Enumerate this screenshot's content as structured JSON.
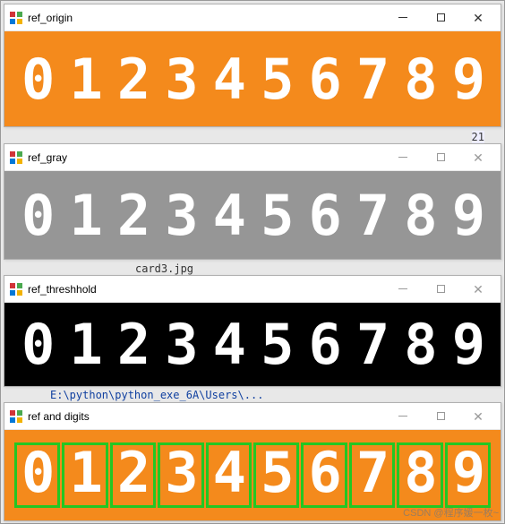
{
  "windows": [
    {
      "id": "w1",
      "title": "ref_origin",
      "active": true,
      "digits": [
        "0",
        "1",
        "2",
        "3",
        "4",
        "5",
        "6",
        "7",
        "8",
        "9"
      ],
      "style": "orange"
    },
    {
      "id": "w2",
      "title": "ref_gray",
      "active": false,
      "digits": [
        "0",
        "1",
        "2",
        "3",
        "4",
        "5",
        "6",
        "7",
        "8",
        "9"
      ],
      "style": "gray"
    },
    {
      "id": "w3",
      "title": "ref_threshhold",
      "active": false,
      "digits": [
        "0",
        "1",
        "2",
        "3",
        "4",
        "5",
        "6",
        "7",
        "8",
        "9"
      ],
      "style": "black"
    },
    {
      "id": "w4",
      "title": "ref and digits",
      "active": false,
      "digits": [
        "0",
        "1",
        "2",
        "3",
        "4",
        "5",
        "6",
        "7",
        "8",
        "9"
      ],
      "style": "orange-boxed"
    }
  ],
  "bg_fragments": {
    "card_file": "card3.jpg",
    "path_frag": "E:\\python\\python_exe_6A\\Users\\...",
    "num_frag": "21"
  },
  "watermark": "CSDN @程序媛一枚~"
}
